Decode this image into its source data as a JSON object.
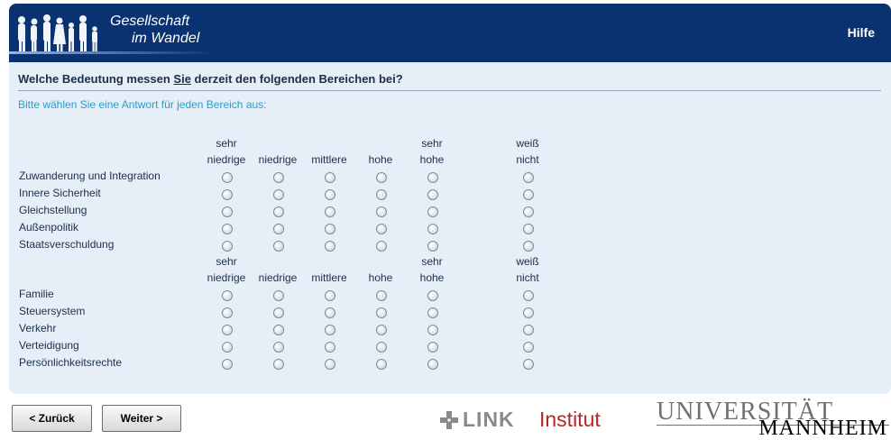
{
  "header": {
    "logo_line1": "Gesellschaft",
    "logo_line2": "im Wandel",
    "help_label": "Hilfe"
  },
  "question": {
    "prefix": "Welche Bedeutung messen ",
    "emphasis": "Sie",
    "suffix": " derzeit den folgenden Bereichen bei?"
  },
  "instruction": "Bitte wählen Sie eine Antwort für jeden Bereich aus:",
  "scale_columns": [
    {
      "line1": "sehr",
      "line2": "niedrige"
    },
    {
      "line1": "",
      "line2": "niedrige"
    },
    {
      "line1": "",
      "line2": "mittlere"
    },
    {
      "line1": "",
      "line2": "hohe"
    },
    {
      "line1": "sehr",
      "line2": "hohe"
    },
    {
      "line1": "weiß",
      "line2": "nicht"
    }
  ],
  "group1_items": [
    "Zuwanderung und Integration",
    "Innere Sicherheit",
    "Gleichstellung",
    "Außenpolitik",
    "Staatsverschuldung"
  ],
  "group2_items": [
    "Familie",
    "Steuersystem",
    "Verkehr",
    "Verteidigung",
    "Persönlichkeitsrechte"
  ],
  "nav": {
    "back_label": "< Zurück",
    "next_label": "Weiter >"
  },
  "footer": {
    "link_word": "LINK",
    "link_institut": "Institut",
    "uni_line1": "UNIVERSITÄT",
    "uni_line2": "MANNHEIM"
  },
  "colors": {
    "header_bg": "#0a3270",
    "panel_bg": "#e6eef8",
    "instruction_text": "#2a9ec6",
    "link_red": "#b42626"
  }
}
